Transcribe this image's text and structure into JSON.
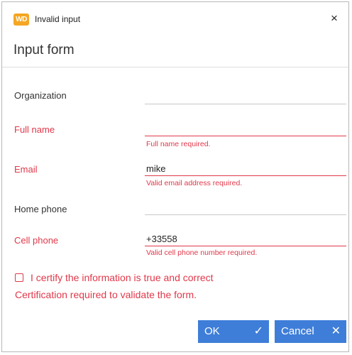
{
  "window": {
    "app_icon_text": "WD",
    "title": "Invalid input",
    "close_glyph": "×"
  },
  "form": {
    "title": "Input form",
    "fields": [
      {
        "label": "Organization",
        "value": "",
        "error": ""
      },
      {
        "label": "Full name",
        "value": "",
        "error": "Full name required."
      },
      {
        "label": "Email",
        "value": "mike",
        "error": "Valid email address required."
      },
      {
        "label": "Home phone",
        "value": "",
        "error": ""
      },
      {
        "label": "Cell phone",
        "value": "+33558",
        "error": "Valid cell phone number required."
      }
    ],
    "certify": {
      "label": "I certify the information is true and correct",
      "checked": false,
      "error": "Certification required to validate the form."
    }
  },
  "buttons": {
    "ok": {
      "label": "OK",
      "icon": "check-icon",
      "glyph": "✓"
    },
    "cancel": {
      "label": "Cancel",
      "icon": "close-icon",
      "glyph": "✕"
    }
  },
  "colors": {
    "error": "#e0384a",
    "accent": "#3e7ed8",
    "app_icon": "#f5a623"
  }
}
